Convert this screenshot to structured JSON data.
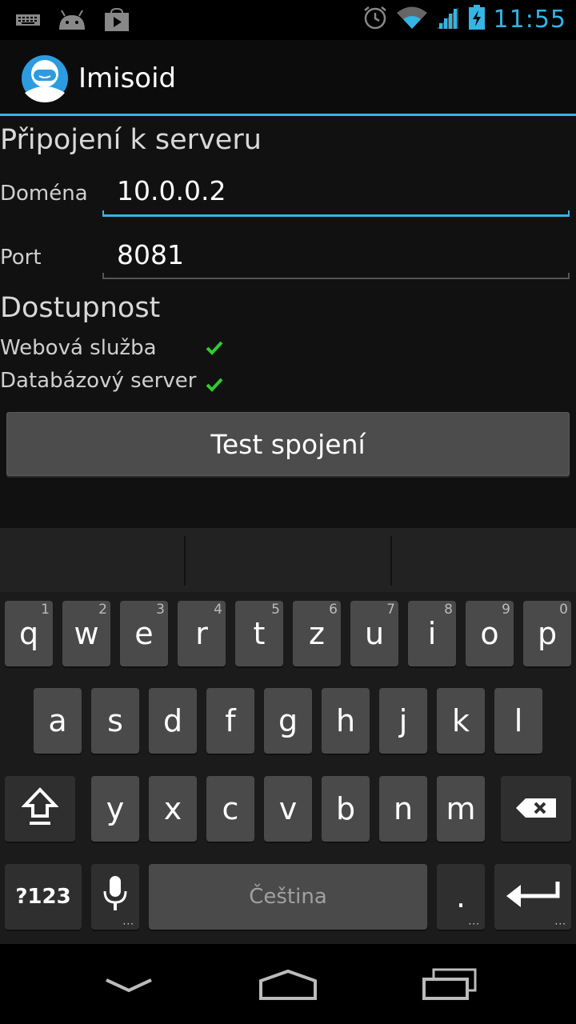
{
  "status_bar": {
    "time": "11:55",
    "icons": [
      "keyboard-icon",
      "android-icon",
      "play-store-icon",
      "alarm-icon",
      "wifi-icon",
      "signal-icon",
      "battery-charging-icon"
    ]
  },
  "action_bar": {
    "title": "Imisoid",
    "logo": "user-avatar-icon"
  },
  "connection": {
    "heading": "Připojení k serveru",
    "domain_label": "Doména",
    "domain_value": "10.0.0.2",
    "port_label": "Port",
    "port_value": "8081"
  },
  "availability": {
    "heading": "Dostupnost",
    "items": [
      {
        "label": "Webová služba",
        "status": "ok"
      },
      {
        "label": "Databázový server",
        "status": "ok"
      }
    ]
  },
  "test_button_label": "Test spojení",
  "keyboard": {
    "row1": [
      {
        "k": "q",
        "h": "1"
      },
      {
        "k": "w",
        "h": "2"
      },
      {
        "k": "e",
        "h": "3"
      },
      {
        "k": "r",
        "h": "4"
      },
      {
        "k": "t",
        "h": "5"
      },
      {
        "k": "z",
        "h": "6"
      },
      {
        "k": "u",
        "h": "7"
      },
      {
        "k": "i",
        "h": "8"
      },
      {
        "k": "o",
        "h": "9"
      },
      {
        "k": "p",
        "h": "0"
      }
    ],
    "row2": [
      "a",
      "s",
      "d",
      "f",
      "g",
      "h",
      "j",
      "k",
      "l"
    ],
    "row3": [
      "y",
      "x",
      "c",
      "v",
      "b",
      "n",
      "m"
    ],
    "symbols_label": "?123",
    "space_label": "Čeština",
    "period_label": ".",
    "accent_color": "#33b5e5",
    "check_color": "#2ecc2e"
  },
  "nav_bar": {
    "icons": [
      "back-down-icon",
      "home-icon",
      "recent-apps-icon"
    ]
  }
}
